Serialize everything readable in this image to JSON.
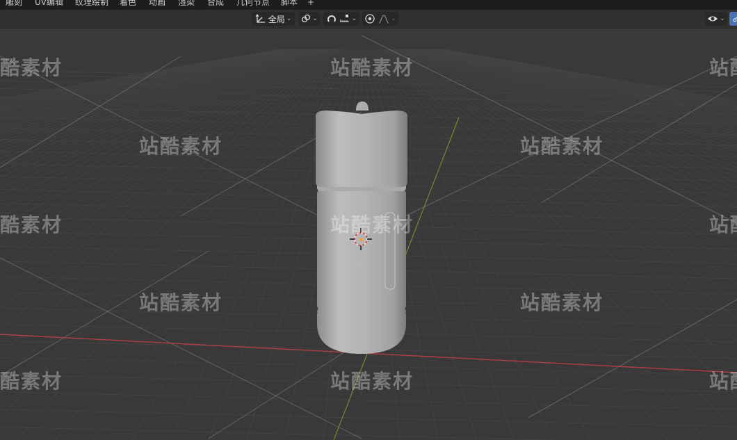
{
  "workspace_tabs": [
    "雕刻",
    "UV编辑",
    "纹理绘制",
    "着色",
    "动画",
    "渲染",
    "合成",
    "几何节点",
    "脚本"
  ],
  "add_workspace_label": "+",
  "header": {
    "transform_orientation": "全局"
  },
  "watermark_text": "站酷素材",
  "icons": {
    "transform_orientation": "axes-icon",
    "pivot": "link-pivot-icon",
    "snap": "magnet-icon",
    "snap_target": "snap-increment-icon",
    "proportional_edit": "proportional-edit-icon",
    "falloff": "falloff-curve-icon",
    "visibility": "eye-icon",
    "gizmo": "gizmo-icon"
  },
  "colors": {
    "x_axis": "#b13f45",
    "y_axis": "#6b8f2c",
    "grid_bg": "#393939",
    "model": "#b6b6b6"
  }
}
